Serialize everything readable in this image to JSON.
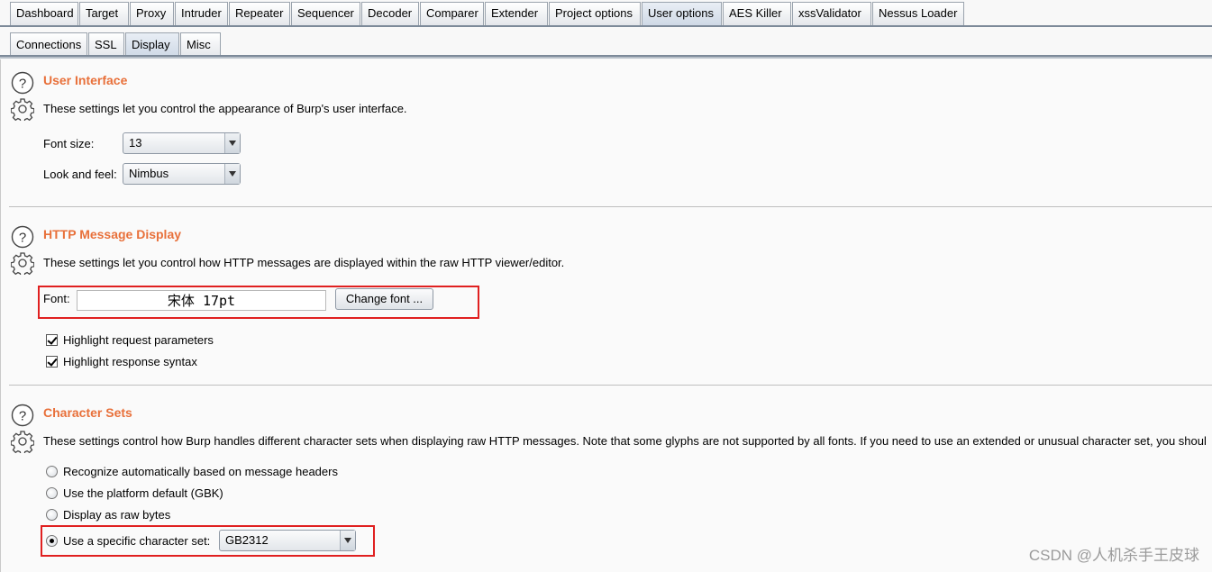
{
  "main_tabs": [
    "Dashboard",
    "Target",
    "Proxy",
    "Intruder",
    "Repeater",
    "Sequencer",
    "Decoder",
    "Comparer",
    "Extender",
    "Project options",
    "User options",
    "AES Killer",
    "xssValidator",
    "Nessus Loader"
  ],
  "main_tab_active": "User options",
  "sub_tabs": [
    "Connections",
    "SSL",
    "Display",
    "Misc"
  ],
  "sub_tab_active": "Display",
  "user_interface": {
    "title": "User Interface",
    "description": "These settings let you control the appearance of Burp's user interface.",
    "font_size_label": "Font size:",
    "font_size_value": "13",
    "look_feel_label": "Look and feel:",
    "look_feel_value": "Nimbus"
  },
  "http_display": {
    "title": "HTTP Message Display",
    "description": "These settings let you control how HTTP messages are displayed within the raw HTTP viewer/editor.",
    "font_label": "Font:",
    "font_value": "宋体 17pt",
    "change_font_button": "Change font ...",
    "highlight_request_label": "Highlight request parameters",
    "highlight_request_checked": true,
    "highlight_response_label": "Highlight response syntax",
    "highlight_response_checked": true
  },
  "character_sets": {
    "title": "Character Sets",
    "description": "These settings control how Burp handles different character sets when displaying raw HTTP messages. Note that some glyphs are not supported by all fonts. If you need to use an extended or unusual character set, you shoul",
    "options": [
      "Recognize automatically based on message headers",
      "Use the platform default (GBK)",
      "Display as raw bytes",
      "Use a specific character set:"
    ],
    "selected_option": "Use a specific character set:",
    "specific_charset_value": "GB2312"
  },
  "watermark": "CSDN @人机杀手王皮球",
  "colors": {
    "section_title": "#e8703a",
    "highlight_box": "#e02020",
    "tab_line": "#7d8a99"
  }
}
